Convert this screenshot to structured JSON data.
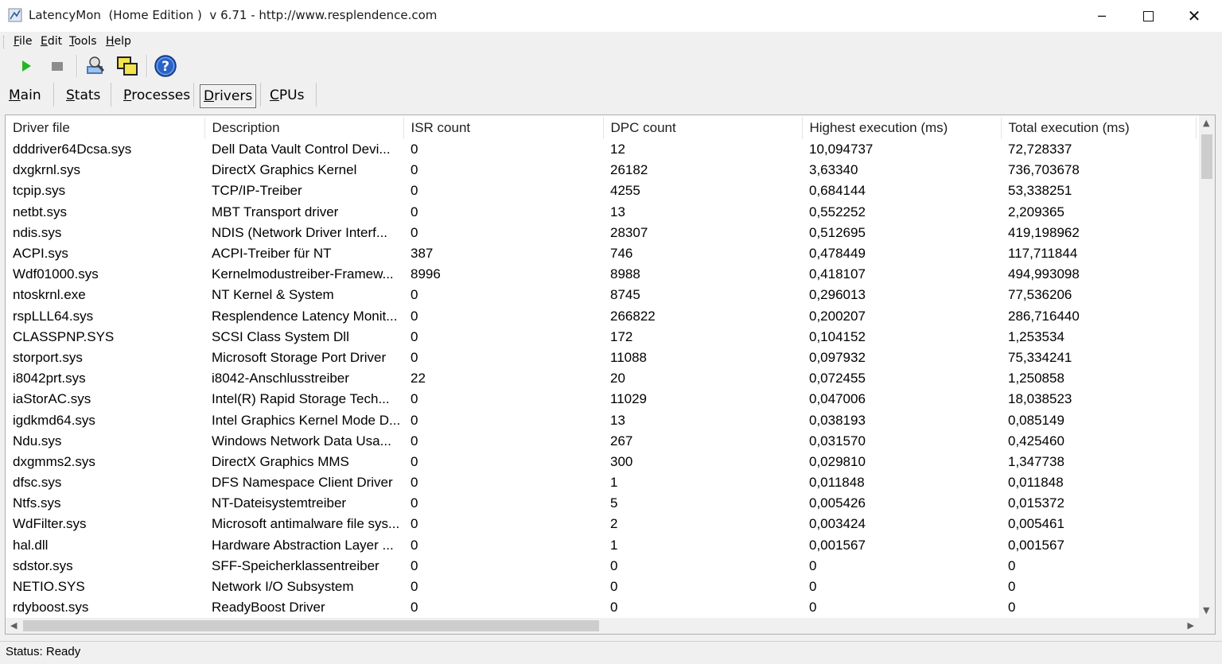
{
  "window": {
    "title": "LatencyMon  (Home Edition )  v 6.71 - http://www.resplendence.com"
  },
  "menu": {
    "file": {
      "first": "F",
      "rest": "ile"
    },
    "edit": {
      "first": "E",
      "rest": "dit"
    },
    "tools": {
      "first": "T",
      "rest": "ools"
    },
    "help": {
      "first": "H",
      "rest": "elp"
    }
  },
  "toolbar": {
    "icons": [
      "play-icon",
      "stop-icon",
      "analyze-icon",
      "windows-icon",
      "help-icon"
    ]
  },
  "tabs": [
    {
      "first": "M",
      "rest": "ain"
    },
    {
      "first": "S",
      "rest": "tats"
    },
    {
      "first": "P",
      "rest": "rocesses"
    },
    {
      "first": "D",
      "rest": "rivers"
    },
    {
      "first": "C",
      "rest": "PUs"
    }
  ],
  "active_tab": "Drivers",
  "table": {
    "headers": [
      "Driver file",
      "Description",
      "ISR count",
      "DPC count",
      "Highest execution (ms)",
      "Total execution (ms)"
    ],
    "rows": [
      [
        "dddriver64Dcsa.sys",
        "Dell Data Vault Control Devi...",
        "0",
        "12",
        "10,094737",
        "72,728337"
      ],
      [
        "dxgkrnl.sys",
        "DirectX Graphics Kernel",
        "0",
        "26182",
        "3,63340",
        "736,703678"
      ],
      [
        "tcpip.sys",
        "TCP/IP-Treiber",
        "0",
        "4255",
        "0,684144",
        "53,338251"
      ],
      [
        "netbt.sys",
        "MBT Transport driver",
        "0",
        "13",
        "0,552252",
        "2,209365"
      ],
      [
        "ndis.sys",
        "NDIS (Network Driver Interf...",
        "0",
        "28307",
        "0,512695",
        "419,198962"
      ],
      [
        "ACPI.sys",
        "ACPI-Treiber für NT",
        "387",
        "746",
        "0,478449",
        "117,711844"
      ],
      [
        "Wdf01000.sys",
        "Kernelmodustreiber-Framew...",
        "8996",
        "8988",
        "0,418107",
        "494,993098"
      ],
      [
        "ntoskrnl.exe",
        "NT Kernel & System",
        "0",
        "8745",
        "0,296013",
        "77,536206"
      ],
      [
        "rspLLL64.sys",
        "Resplendence Latency Monit...",
        "0",
        "266822",
        "0,200207",
        "286,716440"
      ],
      [
        "CLASSPNP.SYS",
        "SCSI Class System Dll",
        "0",
        "172",
        "0,104152",
        "1,253534"
      ],
      [
        "storport.sys",
        "Microsoft Storage Port Driver",
        "0",
        "11088",
        "0,097932",
        "75,334241"
      ],
      [
        "i8042prt.sys",
        "i8042-Anschlusstreiber",
        "22",
        "20",
        "0,072455",
        "1,250858"
      ],
      [
        "iaStorAC.sys",
        "Intel(R) Rapid Storage Tech...",
        "0",
        "11029",
        "0,047006",
        "18,038523"
      ],
      [
        "igdkmd64.sys",
        "Intel Graphics Kernel Mode D...",
        "0",
        "13",
        "0,038193",
        "0,085149"
      ],
      [
        "Ndu.sys",
        "Windows Network Data Usa...",
        "0",
        "267",
        "0,031570",
        "0,425460"
      ],
      [
        "dxgmms2.sys",
        "DirectX Graphics MMS",
        "0",
        "300",
        "0,029810",
        "1,347738"
      ],
      [
        "dfsc.sys",
        "DFS Namespace Client Driver",
        "0",
        "1",
        "0,011848",
        "0,011848"
      ],
      [
        "Ntfs.sys",
        "NT-Dateisystemtreiber",
        "0",
        "5",
        "0,005426",
        "0,015372"
      ],
      [
        "WdFilter.sys",
        "Microsoft antimalware file sys...",
        "0",
        "2",
        "0,003424",
        "0,005461"
      ],
      [
        "hal.dll",
        "Hardware Abstraction Layer ...",
        "0",
        "1",
        "0,001567",
        "0,001567"
      ],
      [
        "sdstor.sys",
        "SFF-Speicherklassentreiber",
        "0",
        "0",
        "0",
        "0"
      ],
      [
        "NETIO.SYS",
        "Network I/O Subsystem",
        "0",
        "0",
        "0",
        "0"
      ],
      [
        "rdyboost.sys",
        "ReadyBoost Driver",
        "0",
        "0",
        "0",
        "0"
      ]
    ]
  },
  "status": {
    "text": "Status: Ready"
  }
}
